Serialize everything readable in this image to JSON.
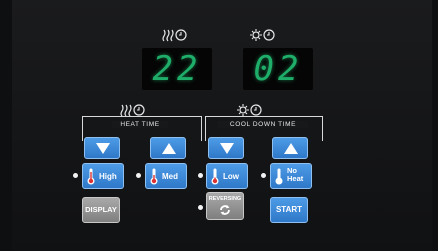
{
  "display": {
    "heat_time_value": "22",
    "cool_down_value": "02"
  },
  "icons": {
    "heat_time": "heat-clock-icon",
    "cool_down": "fan-clock-icon"
  },
  "controls": {
    "heat_time_label": "HEAT TIME",
    "cool_down_time_label": "COOL DOWN TIME",
    "heat_down_symbol": "▼",
    "heat_up_symbol": "▲",
    "cool_down_symbol": "▼",
    "cool_up_symbol": "▲"
  },
  "modes": {
    "high": "High",
    "med": "Med",
    "low": "Low",
    "no_heat_line1": "No",
    "no_heat_line2": "Heat"
  },
  "buttons": {
    "display": "DISPLAY",
    "reversing": "REVERSING",
    "start": "START"
  },
  "colors": {
    "digits": "#1fae6a",
    "button_blue": "#3a86d6",
    "button_gray": "#9a9a9a"
  }
}
